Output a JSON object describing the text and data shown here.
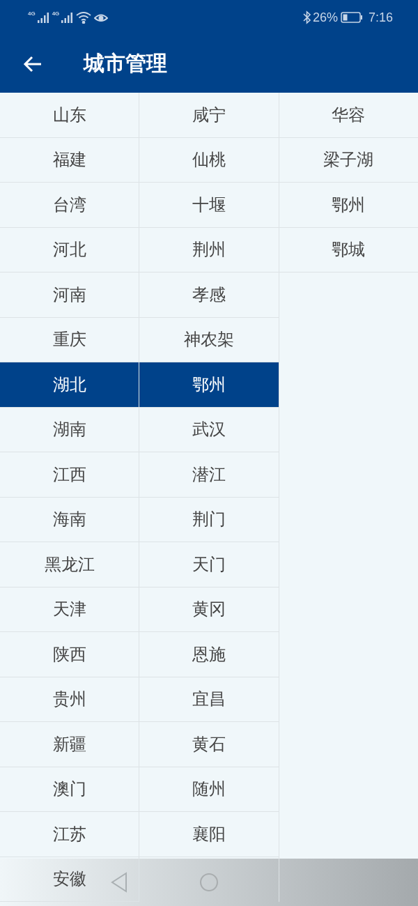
{
  "status_bar": {
    "network_labels": [
      "4G",
      "4G"
    ],
    "battery_text": "26%",
    "time": "7:16"
  },
  "toolbar": {
    "title": "城市管理"
  },
  "columns": [
    {
      "items": [
        {
          "label": "山东",
          "selected": false
        },
        {
          "label": "福建",
          "selected": false
        },
        {
          "label": "台湾",
          "selected": false
        },
        {
          "label": "河北",
          "selected": false
        },
        {
          "label": "河南",
          "selected": false
        },
        {
          "label": "重庆",
          "selected": false
        },
        {
          "label": "湖北",
          "selected": true
        },
        {
          "label": "湖南",
          "selected": false
        },
        {
          "label": "江西",
          "selected": false
        },
        {
          "label": "海南",
          "selected": false
        },
        {
          "label": "黑龙江",
          "selected": false
        },
        {
          "label": "天津",
          "selected": false
        },
        {
          "label": "陕西",
          "selected": false
        },
        {
          "label": "贵州",
          "selected": false
        },
        {
          "label": "新疆",
          "selected": false
        },
        {
          "label": "澳门",
          "selected": false
        },
        {
          "label": "江苏",
          "selected": false
        },
        {
          "label": "安徽",
          "selected": false
        }
      ]
    },
    {
      "items": [
        {
          "label": "咸宁",
          "selected": false
        },
        {
          "label": "仙桃",
          "selected": false
        },
        {
          "label": "十堰",
          "selected": false
        },
        {
          "label": "荆州",
          "selected": false
        },
        {
          "label": "孝感",
          "selected": false
        },
        {
          "label": "神农架",
          "selected": false
        },
        {
          "label": "鄂州",
          "selected": true
        },
        {
          "label": "武汉",
          "selected": false
        },
        {
          "label": "潜江",
          "selected": false
        },
        {
          "label": "荆门",
          "selected": false
        },
        {
          "label": "天门",
          "selected": false
        },
        {
          "label": "黄冈",
          "selected": false
        },
        {
          "label": "恩施",
          "selected": false
        },
        {
          "label": "宜昌",
          "selected": false
        },
        {
          "label": "黄石",
          "selected": false
        },
        {
          "label": "随州",
          "selected": false
        },
        {
          "label": "襄阳",
          "selected": false
        }
      ]
    },
    {
      "items": [
        {
          "label": "华容",
          "selected": false
        },
        {
          "label": "梁子湖",
          "selected": false
        },
        {
          "label": "鄂州",
          "selected": false
        },
        {
          "label": "鄂城",
          "selected": false
        }
      ]
    }
  ]
}
